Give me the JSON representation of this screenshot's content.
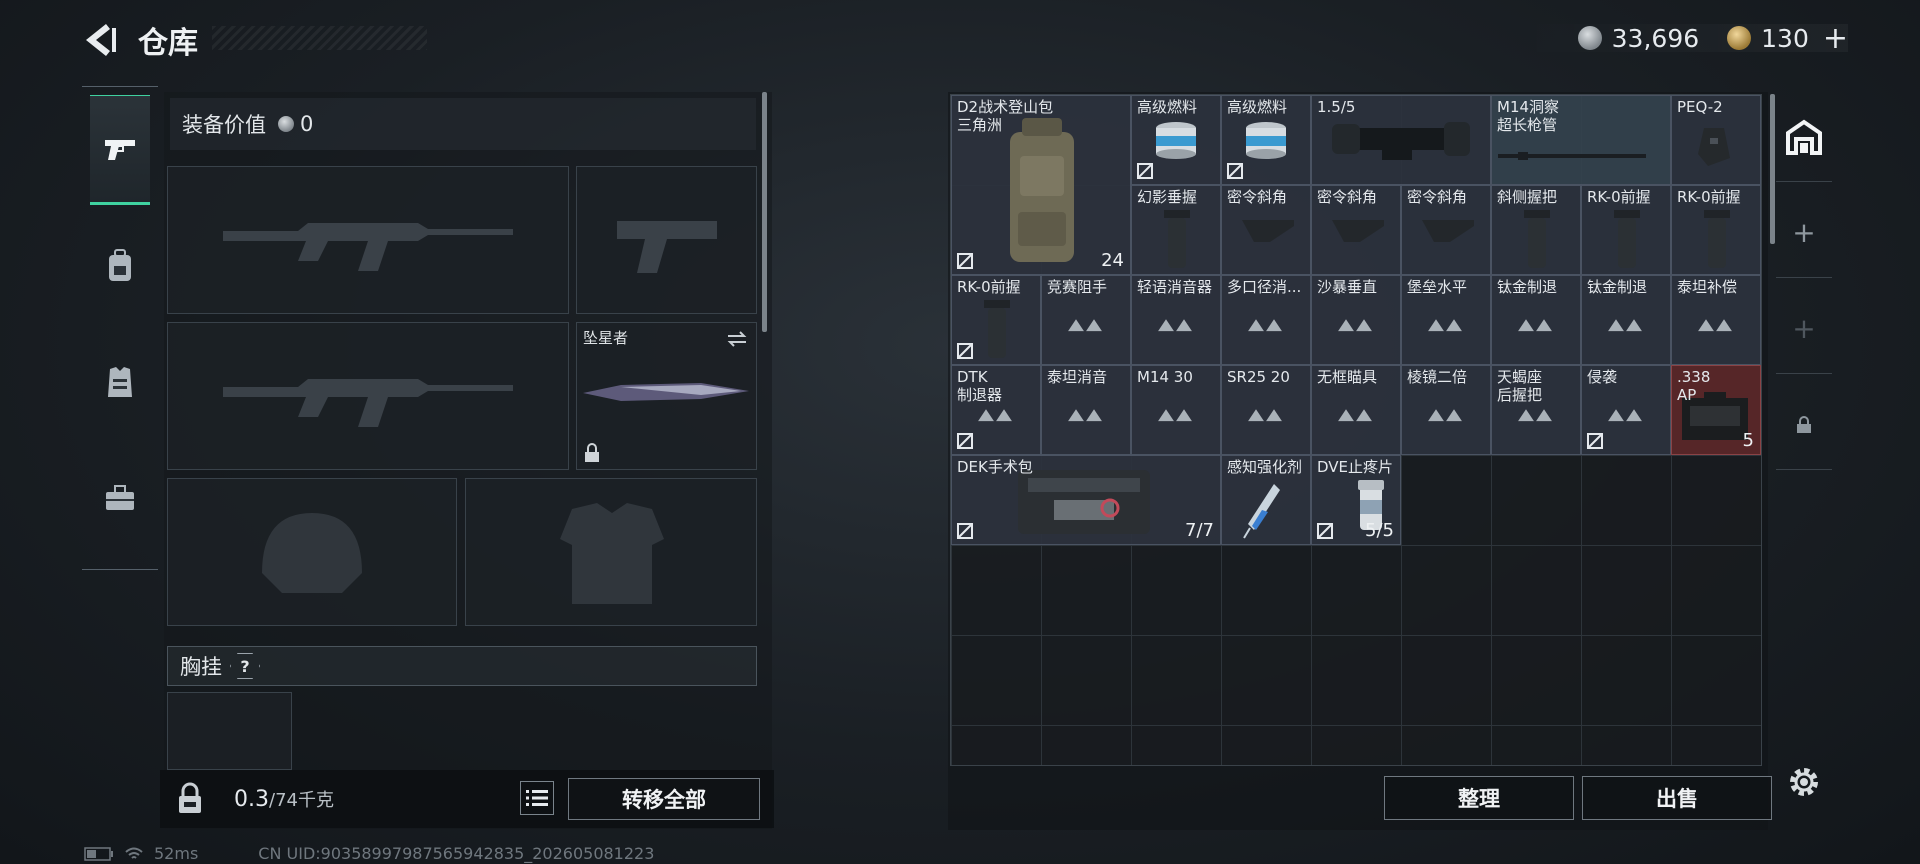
{
  "header": {
    "title": "仓库",
    "currency_silver": "33,696",
    "currency_gold": "130",
    "add_label": "+"
  },
  "tabs": [
    {
      "name": "weapons",
      "icon": "pistol-icon",
      "active": true
    },
    {
      "name": "gear",
      "icon": "backpack-icon",
      "active": false
    },
    {
      "name": "armor",
      "icon": "vest-icon",
      "active": false
    },
    {
      "name": "toolbox",
      "icon": "toolbox-icon",
      "active": false
    }
  ],
  "equipment": {
    "value_label": "装备价值",
    "value": "0",
    "melee_label": "坠星者",
    "chest_label": "胸挂",
    "help": "?"
  },
  "footer": {
    "weight_current": "0.3",
    "weight_max": "/74千克",
    "transfer_all": "转移全部",
    "organize": "整理",
    "sell": "出售"
  },
  "status": {
    "ping": "52ms",
    "uid": "CN UID:90358997987565942835_202605081223"
  },
  "inventory": {
    "items": [
      {
        "name": "D2战术登山包\n三角洲",
        "count": "24",
        "icon": "backpack-icon"
      },
      {
        "name": "高级燃料",
        "icon": "fuel-can-icon"
      },
      {
        "name": "高级燃料",
        "icon": "fuel-can-icon"
      },
      {
        "name": "1.5/5",
        "icon": "scope-icon"
      },
      {
        "name": "M14洞察\n超长枪管",
        "icon": "barrel-icon"
      },
      {
        "name": "PEQ-2",
        "icon": "laser-icon"
      },
      {
        "name": "幻影垂握",
        "icon": "grip-icon"
      },
      {
        "name": "密令斜角",
        "icon": "angled-grip-icon"
      },
      {
        "name": "密令斜角",
        "icon": "angled-grip-icon"
      },
      {
        "name": "密令斜角",
        "icon": "angled-grip-icon"
      },
      {
        "name": "斜侧握把",
        "icon": "grip-icon"
      },
      {
        "name": "RK-0前握",
        "icon": "grip-icon"
      },
      {
        "name": "RK-0前握",
        "icon": "grip-icon"
      },
      {
        "name": "RK-0前握",
        "icon": "grip-icon"
      },
      {
        "name": "竞赛阻手",
        "icon": "placeholder-icon"
      },
      {
        "name": "轻语消音器",
        "icon": "placeholder-icon"
      },
      {
        "name": "多口径消...",
        "icon": "placeholder-icon"
      },
      {
        "name": "沙暴垂直",
        "icon": "placeholder-icon"
      },
      {
        "name": "堡垒水平",
        "icon": "placeholder-icon"
      },
      {
        "name": "钛金制退",
        "icon": "placeholder-icon"
      },
      {
        "name": "钛金制退",
        "icon": "placeholder-icon"
      },
      {
        "name": "泰坦补偿",
        "icon": "placeholder-icon"
      },
      {
        "name": "DTK\n制退器",
        "icon": "placeholder-icon"
      },
      {
        "name": "泰坦消音",
        "icon": "placeholder-icon"
      },
      {
        "name": "M14 30",
        "icon": "placeholder-icon"
      },
      {
        "name": "SR25 20",
        "icon": "placeholder-icon"
      },
      {
        "name": "无框瞄具",
        "icon": "placeholder-icon"
      },
      {
        "name": "棱镜二倍",
        "icon": "placeholder-icon"
      },
      {
        "name": "天蝎座\n后握把",
        "icon": "placeholder-icon"
      },
      {
        "name": "侵袭",
        "icon": "placeholder-icon"
      },
      {
        "name": ".338\nAP",
        "count": "5",
        "icon": "ammo-box-icon"
      },
      {
        "name": "DEK手术包",
        "count": "7/7",
        "icon": "medkit-icon"
      },
      {
        "name": "感知强化剂",
        "icon": "syringe-icon"
      },
      {
        "name": "DVE止疼片",
        "count": "5/5",
        "icon": "pills-icon"
      }
    ]
  },
  "colors": {
    "accent": "#3fd2a0",
    "item_bg": "#2c323e",
    "rare_red": "#62282a"
  }
}
